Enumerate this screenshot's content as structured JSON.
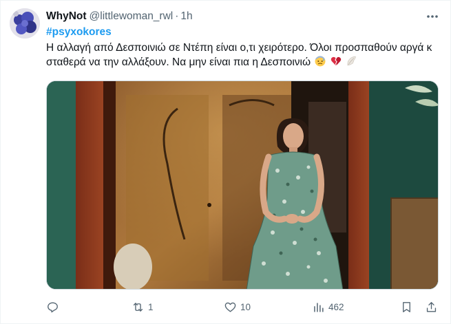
{
  "tweet": {
    "display_name": "WhyNot",
    "handle": "@littlewoman_rwl",
    "separator": "·",
    "time": "1h",
    "hashtag": "#psyxokores",
    "text": "Η αλλαγή από Δεσποινιώ σε Ντέπη είναι ο,τι χειρότερο. Όλοι προσπαθούν αργά κ σταθερά να την αλλάξουν. Να μην είναι πια η Δεσποινιώ",
    "emojis": [
      "anxious-face-emoji",
      "broken-heart-emoji",
      "wing-emoji"
    ]
  },
  "actions": {
    "reply_count": "",
    "retweet_count": "1",
    "like_count": "10",
    "views_count": "462"
  },
  "colors": {
    "link": "#1d9bf0",
    "muted": "#536471",
    "text": "#0f1419"
  },
  "icons": {
    "more": "more-icon",
    "reply": "reply-icon",
    "retweet": "retweet-icon",
    "like": "heart-icon",
    "views": "views-icon",
    "bookmark": "bookmark-icon",
    "share": "share-icon"
  }
}
